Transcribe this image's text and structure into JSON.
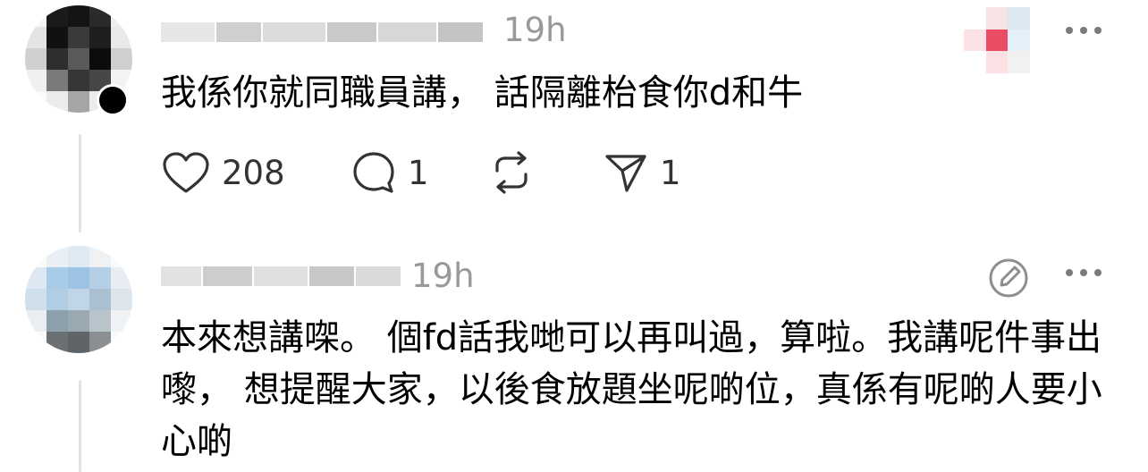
{
  "posts": [
    {
      "time": "19h",
      "text": "我係你就同職員講， 話隔離枱食你d和牛",
      "likes": "208",
      "replies": "1",
      "shares": "1"
    },
    {
      "time": "19h",
      "text": "本來想講㗎。 個fd話我哋可以再叫過，算啦。我講呢件事出嚟， 想提醒大家，以後食放題坐呢啲位，真係有呢啲人要小心啲"
    }
  ],
  "colors": {
    "time": "#999999",
    "icon": "#333333",
    "thread_line": "#e3e3e3"
  },
  "icons": [
    "heart-icon",
    "reply-icon",
    "repost-icon",
    "share-icon",
    "more-icon",
    "edit-icon"
  ]
}
